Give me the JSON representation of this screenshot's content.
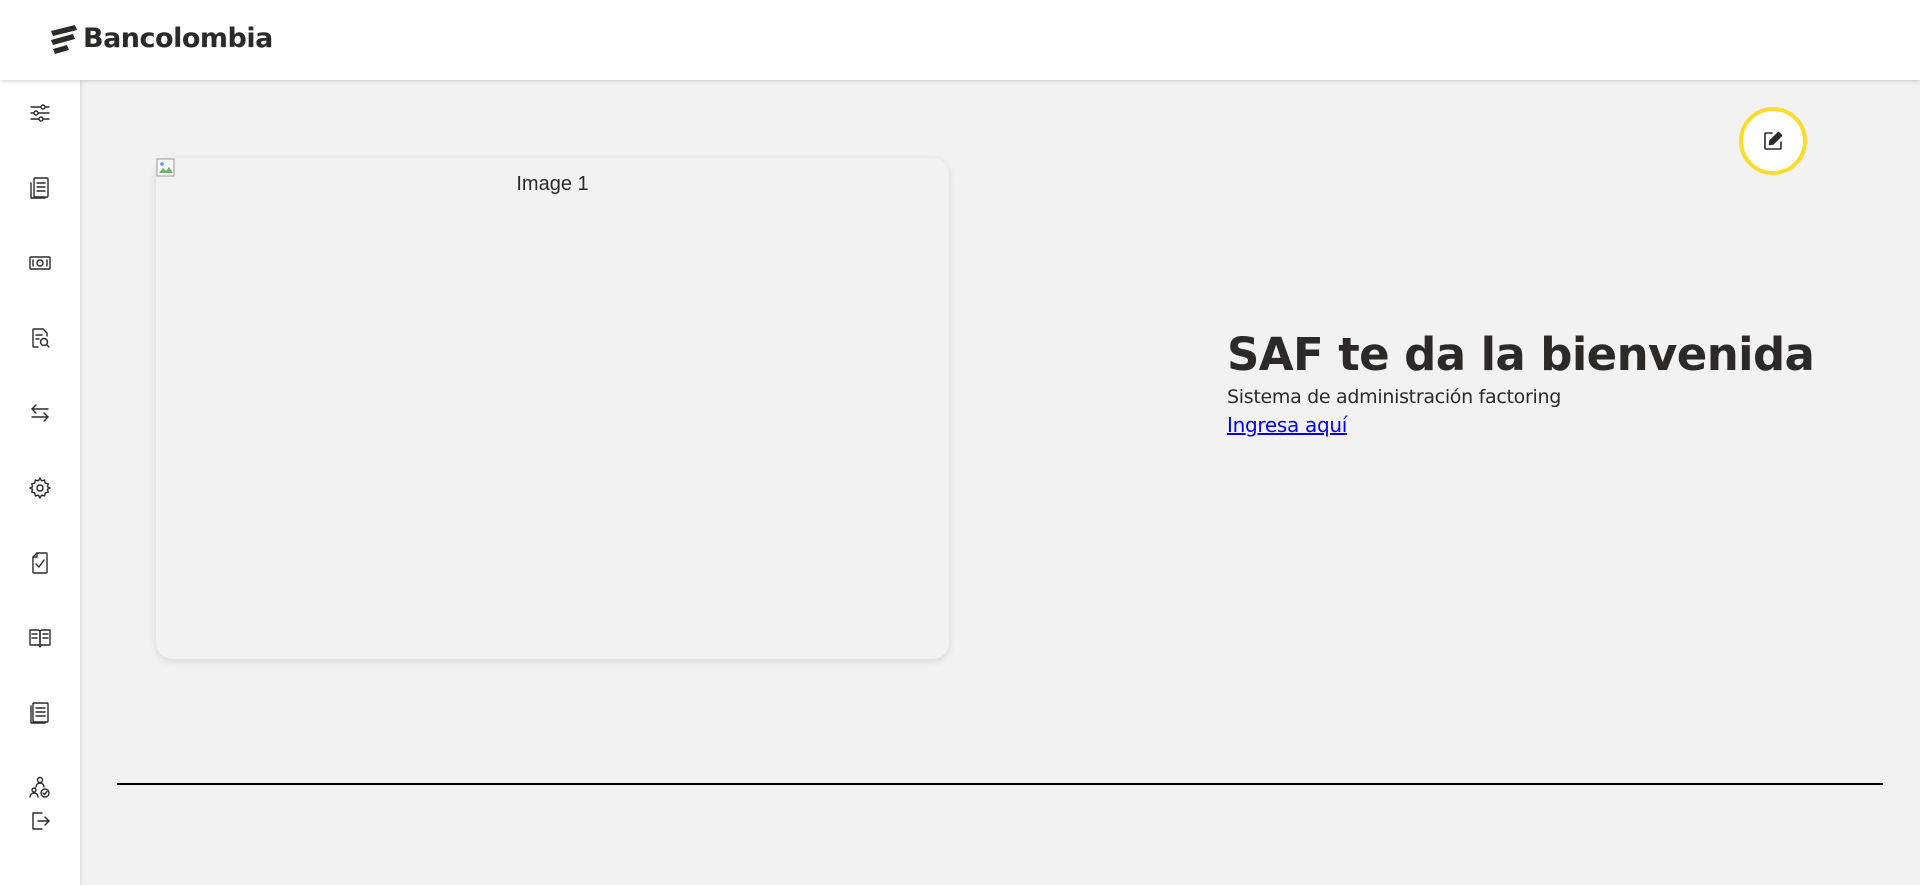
{
  "header": {
    "brand_name": "Bancolombia",
    "logo_icon": "bancolombia-logo-icon"
  },
  "sidebar": {
    "items": [
      {
        "icon": "sliders-icon",
        "name": "sidebar-item-adjustments"
      },
      {
        "icon": "document-list-icon",
        "name": "sidebar-item-documents"
      },
      {
        "icon": "banknote-icon",
        "name": "sidebar-item-money"
      },
      {
        "icon": "file-search-icon",
        "name": "sidebar-item-search-files"
      },
      {
        "icon": "transfer-arrows-icon",
        "name": "sidebar-item-transfers"
      },
      {
        "icon": "gear-icon",
        "name": "sidebar-item-settings"
      },
      {
        "icon": "document-check-icon",
        "name": "sidebar-item-approvals"
      },
      {
        "icon": "open-book-icon",
        "name": "sidebar-item-manual"
      },
      {
        "icon": "notebook-icon",
        "name": "sidebar-item-records"
      },
      {
        "icon": "users-check-icon",
        "name": "sidebar-item-users"
      },
      {
        "icon": "logout-icon",
        "name": "sidebar-item-logout"
      }
    ]
  },
  "main": {
    "image_alt": "Image 1",
    "welcome_title": "SAF te da la bienvenida",
    "welcome_subtitle": "Sistema de administración factoring",
    "login_link": "Ingresa aquí",
    "edit_icon": "edit-icon"
  },
  "colors": {
    "brand_yellow": "#fddb2b",
    "text_dark": "#2c2a29",
    "background": "#f2f2f2",
    "link": "#0000ee"
  }
}
